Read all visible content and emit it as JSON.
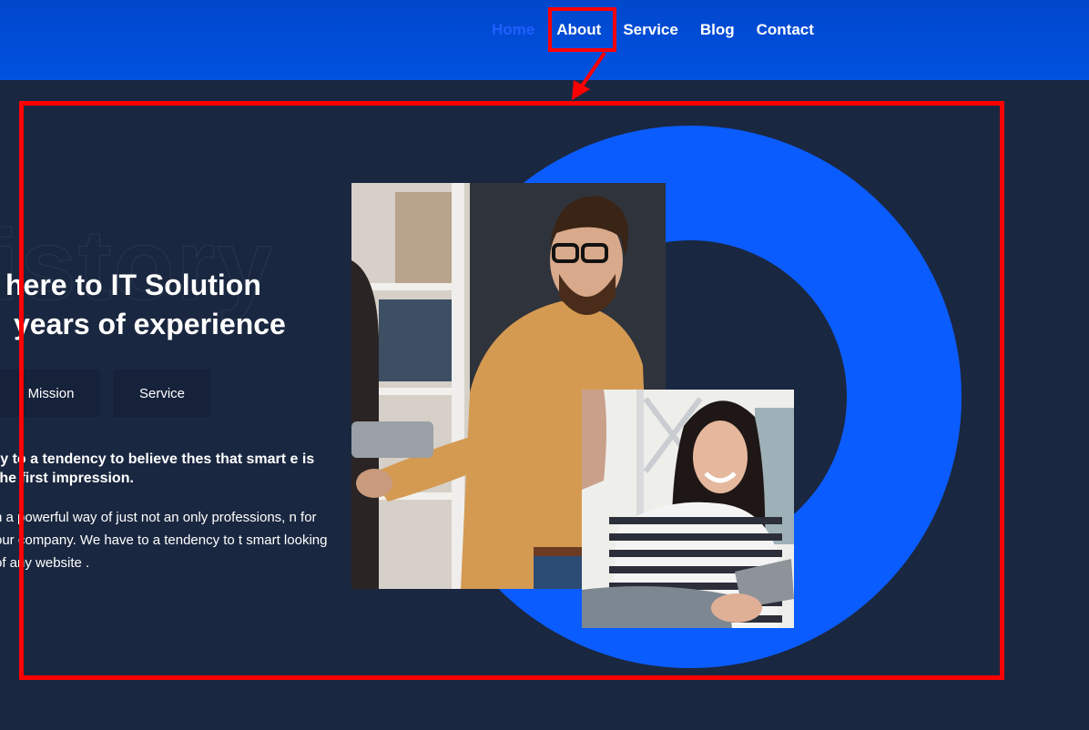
{
  "nav": {
    "items": [
      {
        "label": "Home",
        "active": true
      },
      {
        "label": "About",
        "active": false
      },
      {
        "label": "Service",
        "active": false
      },
      {
        "label": "Blog",
        "active": false
      },
      {
        "label": "Contact",
        "active": false
      }
    ]
  },
  "about": {
    "bg_word": "istory",
    "heading_line1": "here to IT Solution",
    "heading_line2": "years of experience",
    "tabs": [
      "Mission",
      "Service"
    ],
    "lead": "ry to a tendency to believe thes that smart e is the first impression.",
    "body": "n a powerful way of just not an only professions, n for our company. We have to a tendency to t smart looking of any website ."
  },
  "colors": {
    "nav_bg": "#0047cc",
    "nav_active": "#1f5fff",
    "page_bg": "#1a2740",
    "ring": "#0a5cff",
    "annotation": "#ff0000"
  },
  "images": {
    "main": "businessman-handshake-photo",
    "small": "smiling-woman-handshake-photo"
  }
}
